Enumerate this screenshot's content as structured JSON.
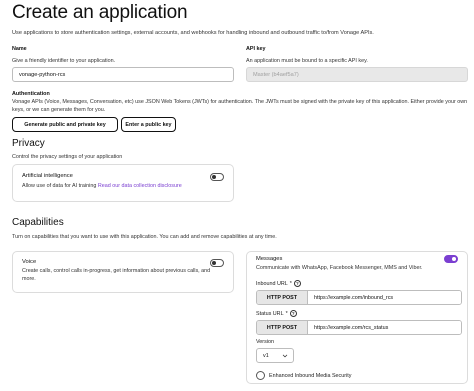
{
  "page": {
    "title": "Create an application",
    "subtitle": "Use applications to store authentication settings, external accounts, and webhooks for handling inbound and outbound traffic to/from Vonage APIs."
  },
  "name_field": {
    "label": "Name",
    "hint": "Give a friendly identifier to your application.",
    "value": "vonage-python-rcs"
  },
  "api_key_field": {
    "label": "API key",
    "hint": "An application must be bound to a specific API key.",
    "value": "Master (b4aef5a7)"
  },
  "authentication": {
    "label": "Authentication",
    "description": "Vonage APIs (Voice, Messages, Conversation, etc) use JSON Web Tokens (JWTs) for authentication. The JWTs must be signed with the private key of this application. Either provide your own keys, or we can generate them for you.",
    "generate_button": "Generate public and private key",
    "enter_button": "Enter a public key"
  },
  "privacy": {
    "title": "Privacy",
    "description": "Control the privacy settings of your application",
    "ai_card": {
      "title": "Artificial intelligence",
      "text": "Allow use of data for AI training",
      "link": "Read our data collection disclosure",
      "enabled": false
    }
  },
  "capabilities": {
    "title": "Capabilities",
    "description": "Turn on capabilities that you want to use with this application. You can add and remove capabilities at any time.",
    "voice": {
      "title": "Voice",
      "text_line1": "Create calls, control calls in-progress, get information about previous calls, and",
      "text_line2": "more.",
      "enabled": false
    },
    "messages": {
      "title": "Messages",
      "text": "Communicate with WhatsApp, Facebook Messenger, MMS and Viber.",
      "enabled": true,
      "inbound_label": "Inbound URL",
      "inbound_method": "HTTP POST",
      "inbound_url": "https://example.com/inbound_rcs",
      "status_label": "Status URL",
      "status_method": "HTTP POST",
      "status_url": "https://example.com/rcs_status",
      "version_label": "Version",
      "version_value": "v1",
      "security_label": "Enhanced Inbound Media Security",
      "security_checked": false,
      "required_marker": "*",
      "info_glyph": "?"
    }
  },
  "colors": {
    "accent": "#7b3fd1",
    "disabled_bg": "#e8e8e8",
    "method_bg": "#e6e6e6"
  },
  "icons": [
    "info-icon",
    "chevron-down-icon"
  ]
}
